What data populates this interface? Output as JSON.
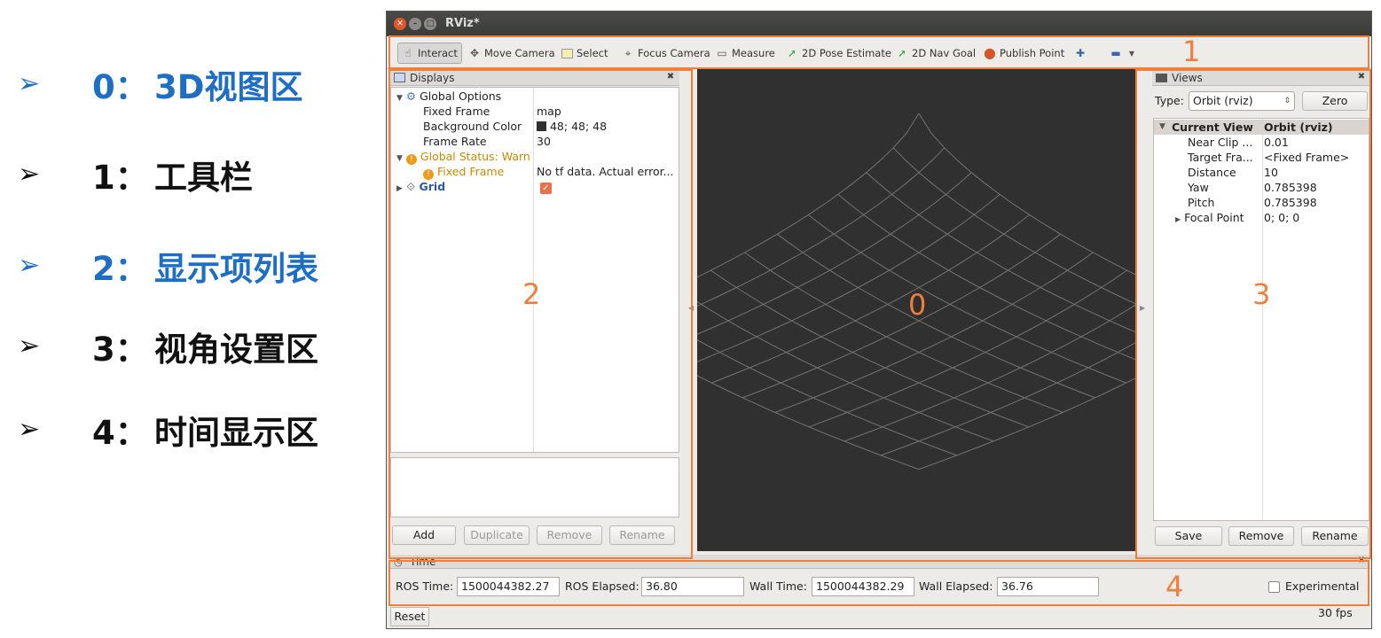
{
  "slide": {
    "bullets": [
      {
        "num": "0：",
        "text": "3D视图区",
        "color": "#1e6fc4"
      },
      {
        "num": "1：",
        "text": "工具栏",
        "color": "#111111"
      },
      {
        "num": "2：",
        "text": "显示项列表",
        "color": "#1e6fc4"
      },
      {
        "num": "3：",
        "text": "视角设置区",
        "color": "#111111"
      },
      {
        "num": "4：",
        "text": "时间显示区",
        "color": "#111111"
      }
    ],
    "arrow": "➢",
    "annotations": {
      "n0": "0",
      "n1": "1",
      "n2": "2",
      "n3": "3",
      "n4": "4"
    },
    "accent_color": "#f07f3c"
  },
  "window": {
    "title": "RViz*",
    "toolbar": {
      "interact": "Interact",
      "move_camera": "Move Camera",
      "select": "Select",
      "focus_camera": "Focus Camera",
      "measure": "Measure",
      "pose_estimate": "2D Pose Estimate",
      "nav_goal": "2D Nav Goal",
      "publish_point": "Publish Point"
    },
    "displays": {
      "header": "Displays",
      "rows": {
        "global_options": "Global Options",
        "fixed_frame_label": "Fixed Frame",
        "fixed_frame_value": "map",
        "bg_color_label": "Background Color",
        "bg_color_value": "48; 48; 48",
        "frame_rate_label": "Frame Rate",
        "frame_rate_value": "30",
        "global_status": "Global Status: Warn",
        "status_fixed_frame": "Fixed Frame",
        "status_fixed_frame_value": "No tf data.  Actual error...",
        "grid": "Grid"
      },
      "buttons": {
        "add": "Add",
        "duplicate": "Duplicate",
        "remove": "Remove",
        "rename": "Rename"
      }
    },
    "views": {
      "header": "Views",
      "type_label": "Type:",
      "type_value": "Orbit (rviz)",
      "zero": "Zero",
      "current_view": "Current View",
      "current_view_value": "Orbit (rviz)",
      "props": [
        {
          "k": "Near Clip ...",
          "v": "0.01"
        },
        {
          "k": "Target Fra...",
          "v": "<Fixed Frame>"
        },
        {
          "k": "Distance",
          "v": "10"
        },
        {
          "k": "Yaw",
          "v": "0.785398"
        },
        {
          "k": "Pitch",
          "v": "0.785398"
        },
        {
          "k": "Focal Point",
          "v": "0; 0; 0"
        }
      ],
      "buttons": {
        "save": "Save",
        "remove": "Remove",
        "rename": "Rename"
      }
    },
    "time": {
      "header": "Time",
      "ros_time_label": "ROS Time:",
      "ros_time": "1500044382.27",
      "ros_elapsed_label": "ROS Elapsed:",
      "ros_elapsed": "36.80",
      "wall_time_label": "Wall Time:",
      "wall_time": "1500044382.29",
      "wall_elapsed_label": "Wall Elapsed:",
      "wall_elapsed": "36.76",
      "experimental": "Experimental",
      "reset": "Reset",
      "fps": "30 fps"
    }
  }
}
